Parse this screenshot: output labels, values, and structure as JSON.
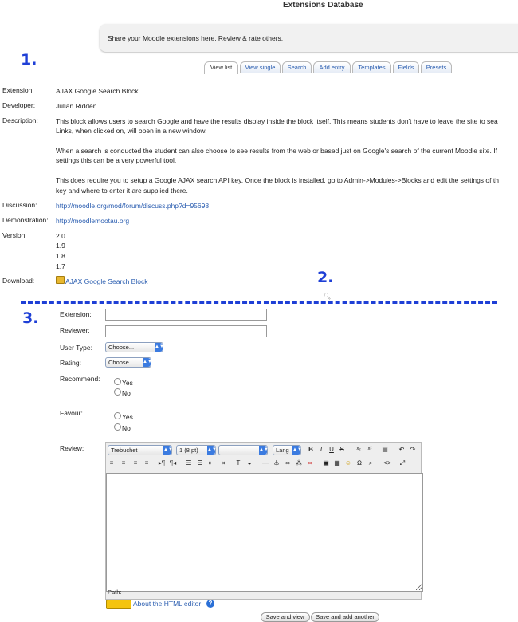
{
  "page": {
    "title": "Extensions Database",
    "intro": "Share your Moodle extensions here. Review & rate others."
  },
  "markers": {
    "m1": "1.",
    "m2": "2.",
    "m3": "3."
  },
  "tabs": [
    "View list",
    "View single",
    "Search",
    "Add entry",
    "Templates",
    "Fields",
    "Presets"
  ],
  "entry": {
    "extension_label": "Extension:",
    "extension": "AJAX Google Search Block",
    "developer_label": "Developer:",
    "developer": "Julian Ridden",
    "description_label": "Description:",
    "description": [
      "This block allows users to search Google and have the results display inside the block itself. This means students don't have to leave the site to sea",
      "Links, when clicked on, will open in a new window.",
      "When a search is conducted the student can also choose to see results from the web or based just on Google's search of the current Moodle site. If",
      "settings this can be a very powerful tool.",
      "This does require you to setup a Google AJAX search API key. Once the block is installed, go to Admin->Modules->Blocks and edit the settings of th",
      "key and where to enter it are supplied there."
    ],
    "discussion_label": "Discussion:",
    "discussion": "http://moodle.org/mod/forum/discuss.php?d=95698",
    "demonstration_label": "Demonstration:",
    "demonstration": "http://moodlemootau.org",
    "version_label": "Version:",
    "versions": [
      "2.0",
      "1.9",
      "1.8",
      "1.7"
    ],
    "download_label": "Download:",
    "download": "AJAX Google Search Block"
  },
  "form": {
    "extension_label": "Extension:",
    "reviewer_label": "Reviewer:",
    "usertype_label": "User Type:",
    "usertype_value": "Choose...",
    "rating_label": "Rating:",
    "rating_value": "Choose...",
    "recommend_label": "Recommend:",
    "favour_label": "Favour:",
    "yes": "Yes",
    "no": "No",
    "review_label": "Review:",
    "font_value": "Trebuchet",
    "size_value": "1 (8 pt)",
    "format_value": "",
    "lang_value": "Lang",
    "path_label": "Path:",
    "html_help": "About the HTML editor",
    "save_view": "Save and view",
    "save_add": "Save and add another"
  }
}
